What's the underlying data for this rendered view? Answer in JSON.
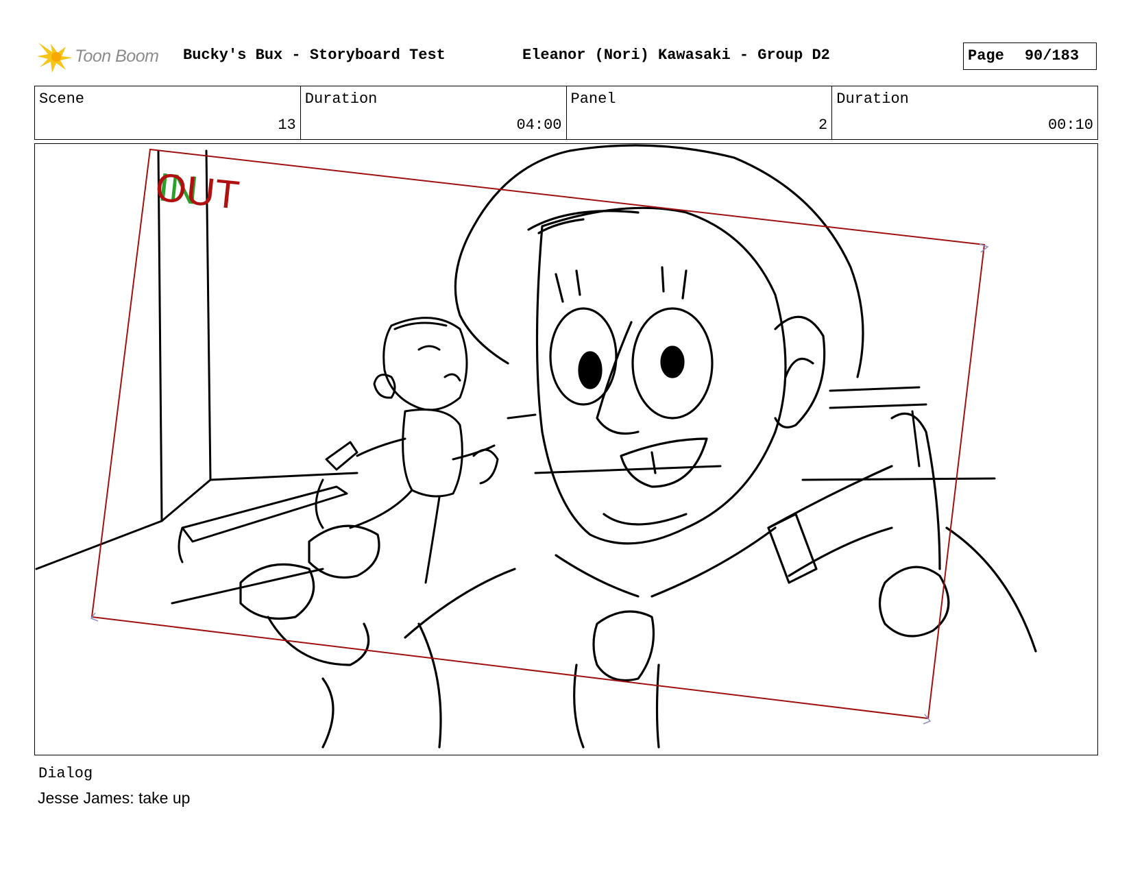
{
  "header": {
    "logo_text": "Toon Boom",
    "title": "Bucky's Bux - Storyboard Test",
    "author": "Eleanor (Nori) Kawasaki - Group D2",
    "page_label": "Page",
    "page_value": "90/183"
  },
  "info": {
    "scene_label": "Scene",
    "scene_value": "13",
    "scene_duration_label": "Duration",
    "scene_duration_value": "04:00",
    "panel_label": "Panel",
    "panel_value": "2",
    "panel_duration_label": "Duration",
    "panel_duration_value": "00:10"
  },
  "panel": {
    "in_marker": "IN",
    "out_marker": "OUT",
    "frame_color": "#a01010",
    "in_color": "#2ca02c",
    "out_color": "#b01010"
  },
  "dialog": {
    "label": "Dialog",
    "text": "Jesse James: take up"
  }
}
